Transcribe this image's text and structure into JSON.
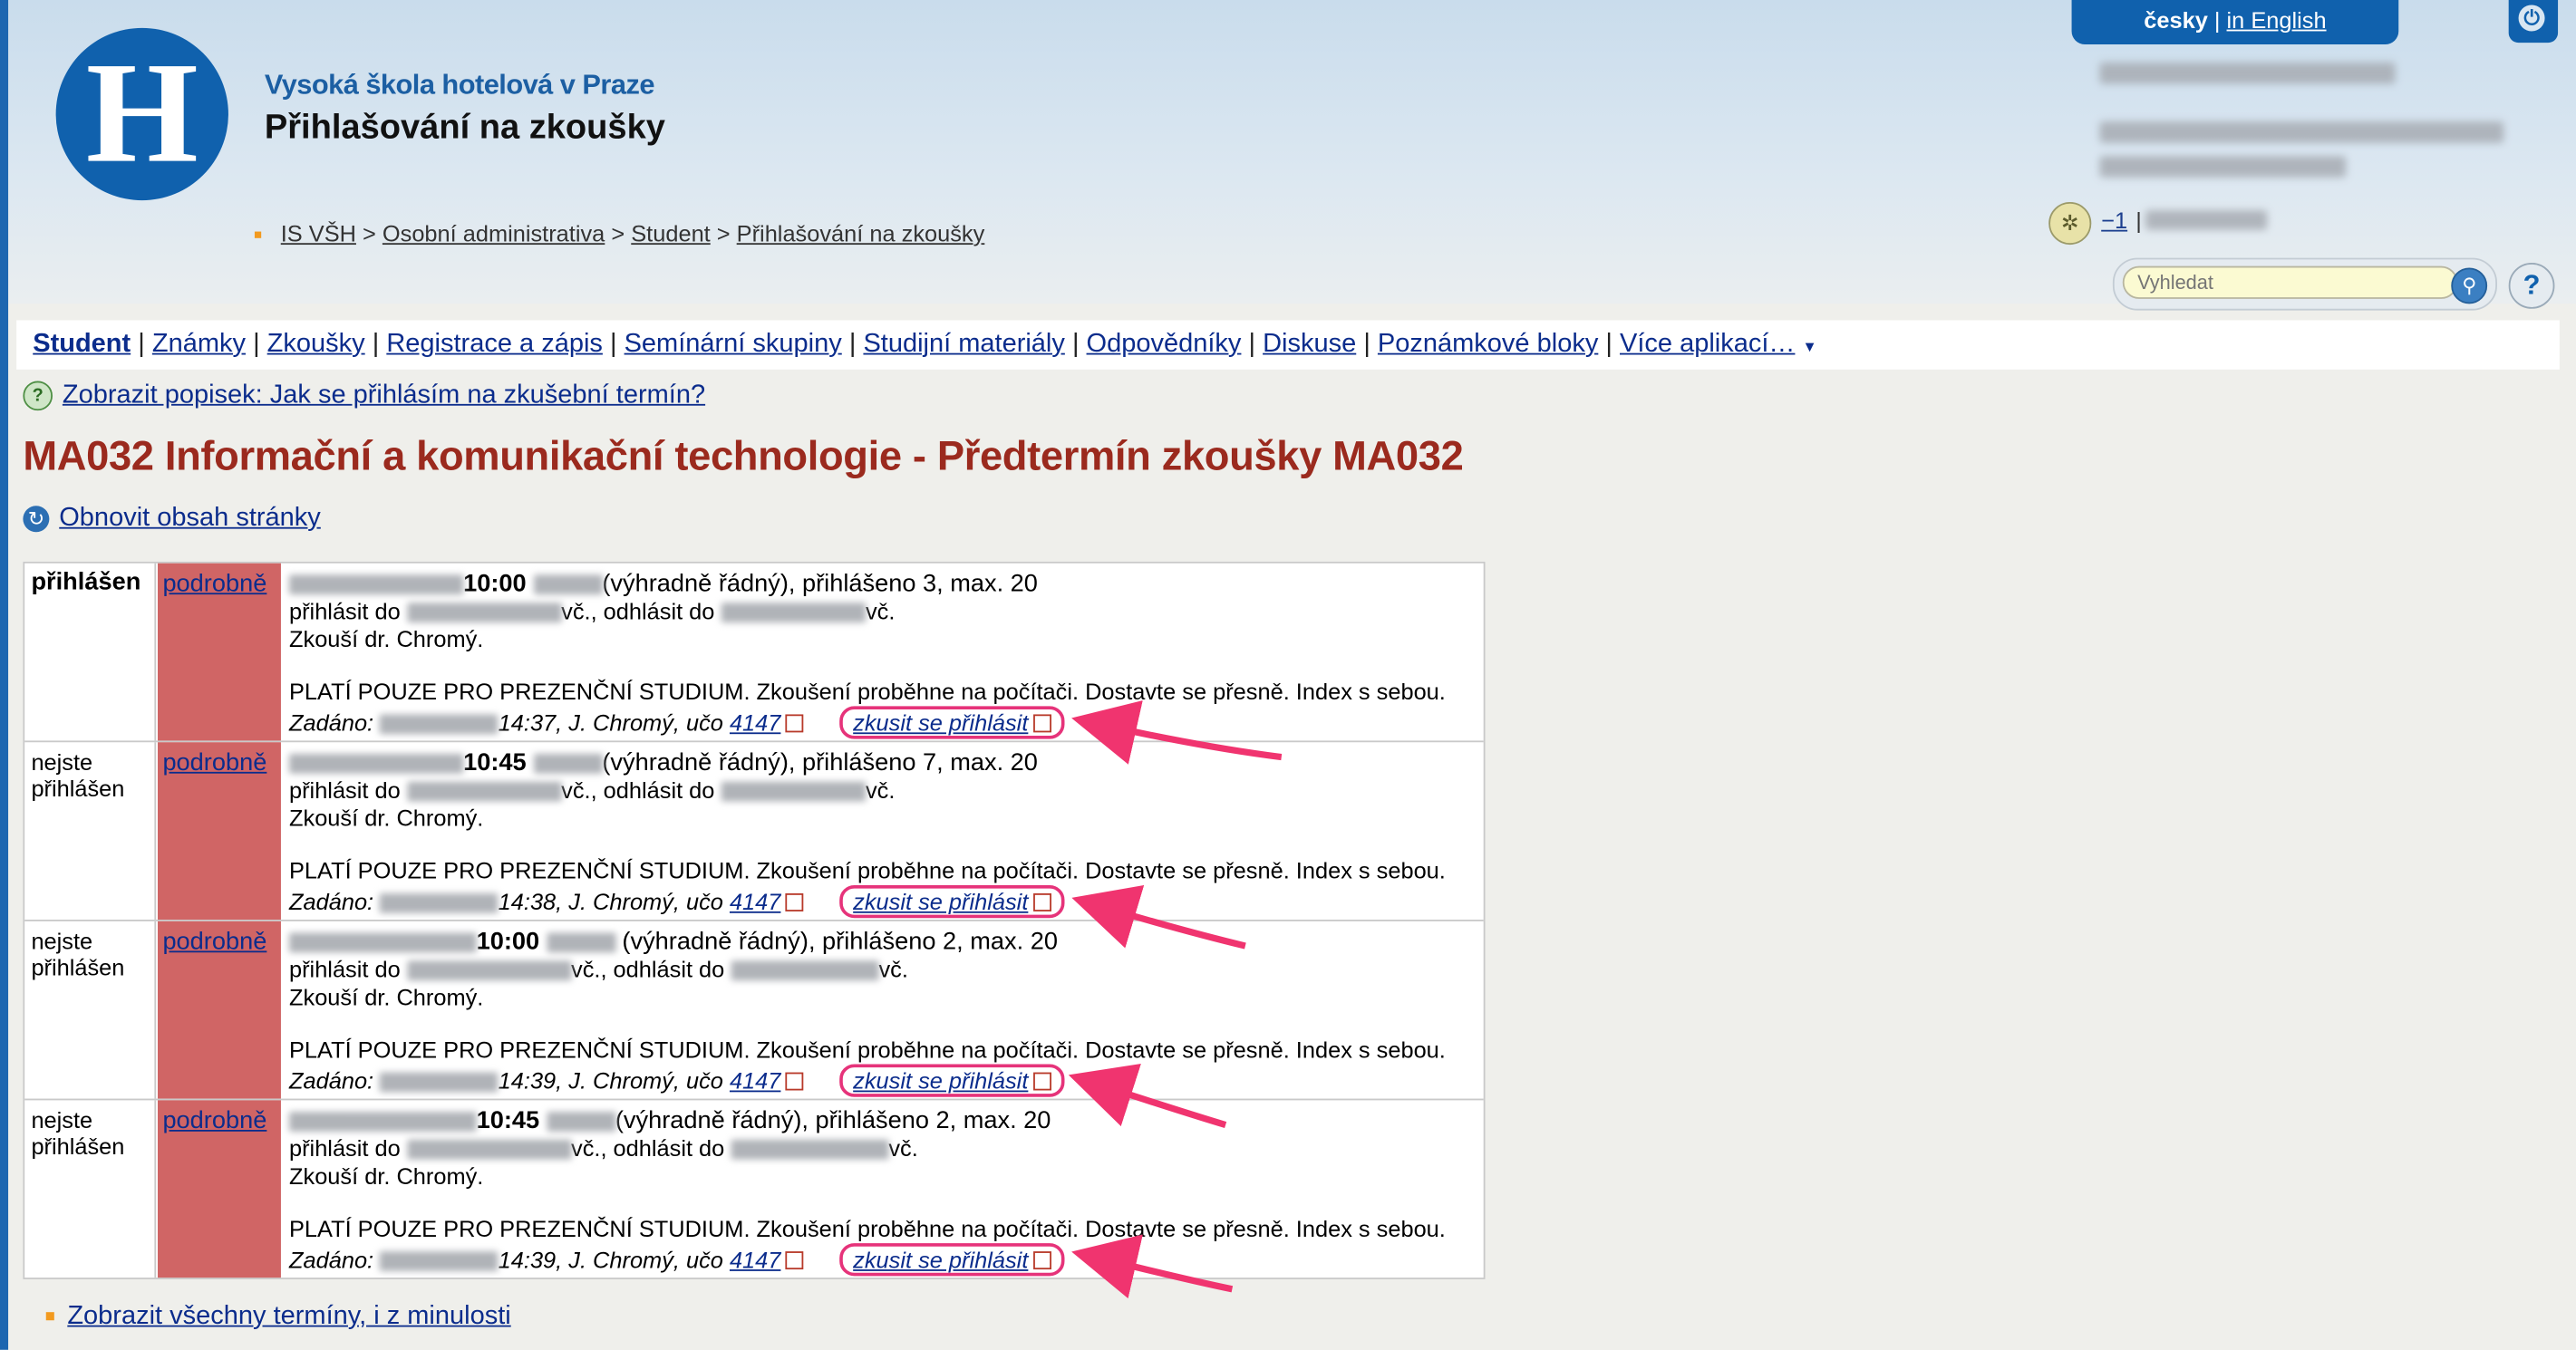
{
  "header": {
    "school_name": "Vysoká škola hotelová v Praze",
    "app_title": "Přihlašování na zkoušky",
    "logo_letter": "H",
    "language": {
      "current": "česky",
      "separator": "|",
      "other": "in English"
    },
    "user_counter": "−1",
    "user_separator": "|"
  },
  "breadcrumb": [
    "IS VŠH",
    "Osobní administrativa",
    "Student",
    "Přihlašování na zkoušky"
  ],
  "breadcrumb_sep": ">",
  "search": {
    "placeholder": "Vyhledat"
  },
  "nav": {
    "items": [
      "Student",
      "Známky",
      "Zkoušky",
      "Registrace a zápis",
      "Semínární skupiny",
      "Studijní materiály",
      "Odpovědníky",
      "Diskuse",
      "Poznámkové bloky",
      "Více aplikací…"
    ],
    "sep": "|"
  },
  "help_link": "Zobrazit popisek: Jak se přihlásím na zkušební termín?",
  "page_title": "MA032 Informační a komunikační technologie - Předtermín zkoušky MA032",
  "refresh_link": "Obnovit obsah stránky",
  "exams": [
    {
      "status": "přihlášen",
      "detail": "podrobně",
      "time": "10:00",
      "type": "(výhradně řádný), přihlášeno 3, max. 20",
      "register_prefix": "přihlásit do",
      "register_suffix": "vč., odhlásit do",
      "unregister_suffix": "vč.",
      "examiner": "Zkouší dr. Chromý.",
      "note": "PLATÍ POUZE PRO PREZENČNÍ STUDIUM. Zkoušení proběhne na počítači. Dostavte se přesně. Index s sebou.",
      "entered_label": "Zadáno:",
      "entered_time": "14:37, J. Chromý, učo",
      "uco": "4147",
      "action": "zkusit se přihlásit"
    },
    {
      "status": "nejste přihlášen",
      "detail": "podrobně",
      "time": "10:45",
      "type": "(výhradně řádný), přihlášeno 7, max. 20",
      "register_prefix": "přihlásit do",
      "register_suffix": "vč., odhlásit do",
      "unregister_suffix": "vč.",
      "examiner": "Zkouší dr. Chromý.",
      "note": "PLATÍ POUZE PRO PREZENČNÍ STUDIUM. Zkoušení proběhne na počítači. Dostavte se přesně. Index s sebou.",
      "entered_label": "Zadáno:",
      "entered_time": "14:38, J. Chromý, učo",
      "uco": "4147",
      "action": "zkusit se přihlásit"
    },
    {
      "status": "nejste přihlášen",
      "detail": "podrobně",
      "time": "10:00",
      "type": "(výhradně řádný), přihlášeno 2, max. 20",
      "register_prefix": "přihlásit do",
      "register_suffix": "vč., odhlásit do",
      "unregister_suffix": "vč.",
      "examiner": "Zkouší dr. Chromý.",
      "note": "PLATÍ POUZE PRO PREZENČNÍ STUDIUM. Zkoušení proběhne na počítači. Dostavte se přesně. Index s sebou.",
      "entered_label": "Zadáno:",
      "entered_time": "14:39, J. Chromý, učo",
      "uco": "4147",
      "action": "zkusit se přihlásit"
    },
    {
      "status": "nejste přihlášen",
      "detail": "podrobně",
      "time": "10:45",
      "type": "(výhradně řádný), přihlášeno 2, max. 20",
      "register_prefix": "přihlásit do",
      "register_suffix": "vč., odhlásit do",
      "unregister_suffix": "vč.",
      "examiner": "Zkouší dr. Chromý.",
      "note": "PLATÍ POUZE PRO PREZENČNÍ STUDIUM. Zkoušení proběhne na počítači. Dostavte se přesně. Index s sebou.",
      "entered_label": "Zadáno:",
      "entered_time": "14:39, J. Chromý, učo",
      "uco": "4147",
      "action": "zkusit se přihlásit"
    }
  ],
  "footer_link": "Zobrazit všechny termíny, i z minulosti",
  "colors": {
    "brand_blue": "#1061ad",
    "title_red": "#9b2a1e",
    "detail_cell": "#d06565",
    "annotation_pink": "#e6337a",
    "link": "#0b2c8c"
  },
  "icons": [
    "logo-h-icon",
    "power-icon",
    "user-status-icon",
    "search-icon",
    "help-icon",
    "help-circle-icon",
    "refresh-icon",
    "external-link-icon"
  ]
}
